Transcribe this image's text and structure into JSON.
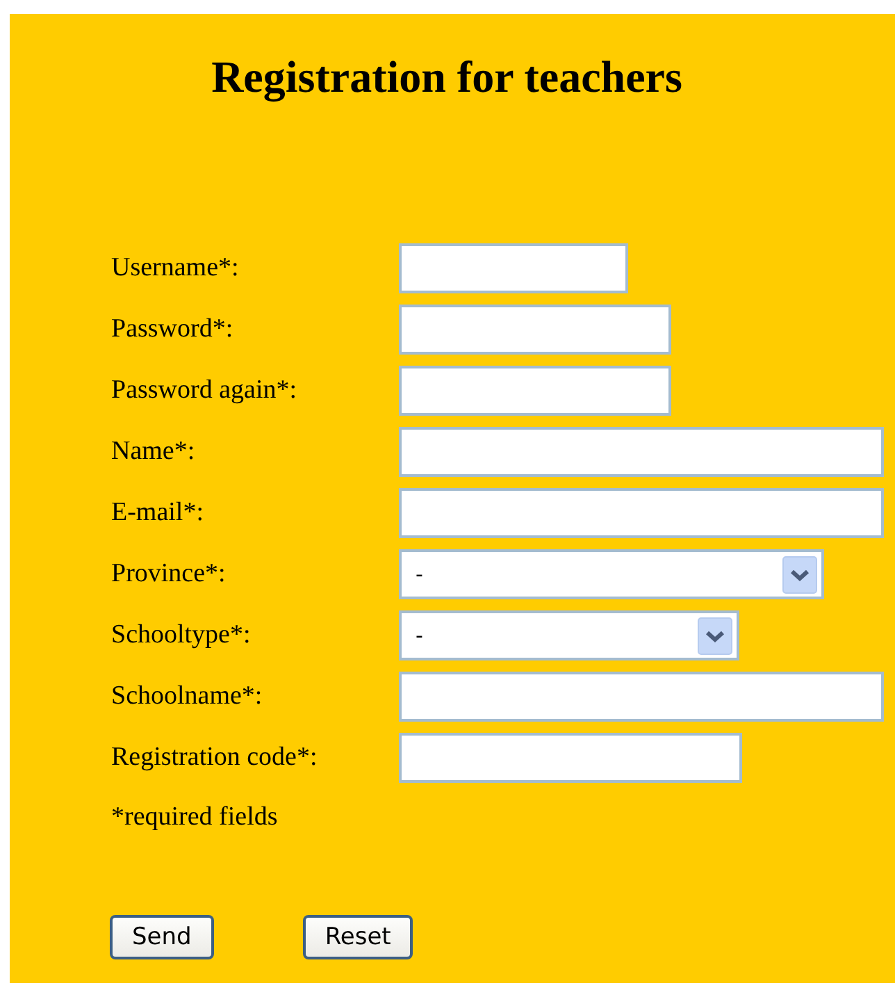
{
  "title": "Registration for teachers",
  "fields": [
    {
      "label": "Username*:",
      "kind": "text"
    },
    {
      "label": "Password*:",
      "kind": "password"
    },
    {
      "label": "Password again*:",
      "kind": "password"
    },
    {
      "label": "Name*:",
      "kind": "text"
    },
    {
      "label": "E-mail*:",
      "kind": "text"
    },
    {
      "label": "Province*:",
      "kind": "select",
      "value": "-"
    },
    {
      "label": "Schooltype*:",
      "kind": "select",
      "value": "-"
    },
    {
      "label": "Schoolname*:",
      "kind": "text"
    },
    {
      "label": "Registration code*:",
      "kind": "text"
    }
  ],
  "note": "*required fields",
  "buttons": [
    "Send",
    "Reset"
  ]
}
